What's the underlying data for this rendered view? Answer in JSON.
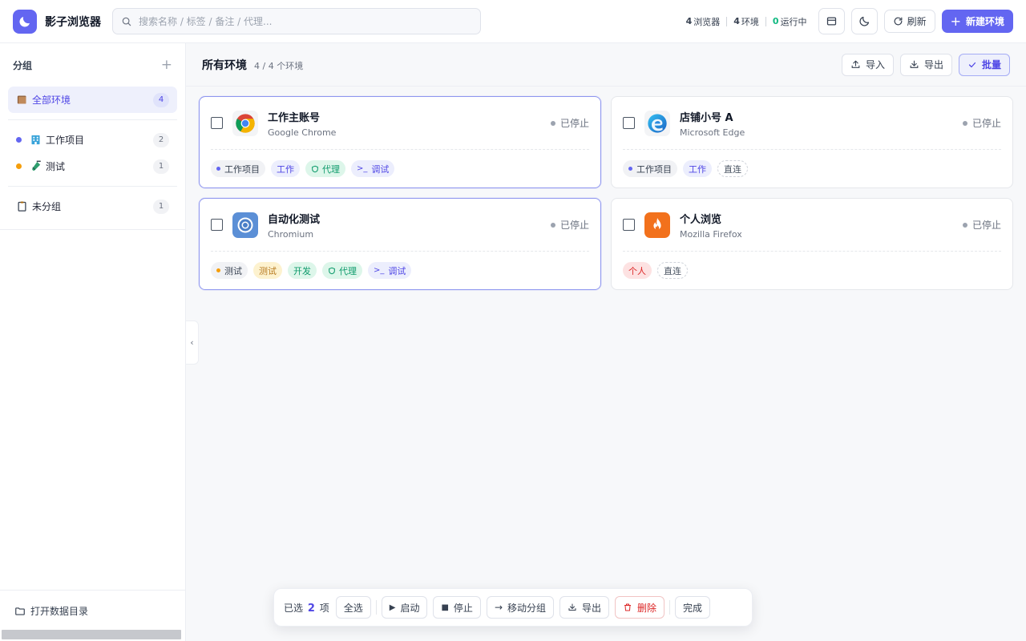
{
  "app": {
    "name": "影子浏览器"
  },
  "search": {
    "placeholder": "搜索名称 / 标签 / 备注 / 代理..."
  },
  "stats": {
    "browsers_count": "4",
    "browsers_label": "浏览器",
    "envs_count": "4",
    "envs_label": "环境",
    "running_count": "0",
    "running_label": "运行中"
  },
  "toolbar": {
    "refresh_label": "刷新",
    "new_label": "新建环境"
  },
  "sidebar": {
    "title": "分组",
    "all": {
      "label": "全部环境",
      "count": "4"
    },
    "groups": [
      {
        "label": "工作项目",
        "count": "2",
        "color": "#6366f1"
      },
      {
        "label": "测试",
        "count": "1",
        "color": "#f59e0b"
      }
    ],
    "ungrouped": {
      "label": "未分组",
      "count": "1"
    },
    "open_dir_label": "打开数据目录"
  },
  "main": {
    "title": "所有环境",
    "subtitle": "4 / 4 个环境",
    "import_label": "导入",
    "export_label": "导出",
    "batch_label": "批量"
  },
  "cards": [
    {
      "name": "工作主账号",
      "browser": "Google Chrome",
      "status": "已停止",
      "selected": true,
      "icon": "chrome-icon",
      "group": "工作项目",
      "tags": [
        "工作"
      ],
      "proxy": "代理",
      "debug": "调试"
    },
    {
      "name": "店铺小号 A",
      "browser": "Microsoft Edge",
      "status": "已停止",
      "selected": false,
      "icon": "edge-icon",
      "group": "工作项目",
      "tags": [
        "工作"
      ],
      "direct": "直连"
    },
    {
      "name": "自动化测试",
      "browser": "Chromium",
      "status": "已停止",
      "selected": true,
      "icon": "chromium-icon",
      "group": "测试",
      "tags": [
        "测试",
        "开发"
      ],
      "proxy": "代理",
      "debug": "调试"
    },
    {
      "name": "个人浏览",
      "browser": "Mozilla Firefox",
      "status": "已停止",
      "selected": false,
      "icon": "firefox-icon",
      "tags": [
        "个人"
      ],
      "direct": "直连"
    }
  ],
  "batch_bar": {
    "selected_prefix": "已选",
    "selected_count": "2",
    "selected_suffix": "项",
    "select_all": "全选",
    "start": "启动",
    "stop": "停止",
    "move_group": "移动分组",
    "export": "导出",
    "delete": "删除",
    "done": "完成"
  },
  "colors": {
    "accent": "#6366f1",
    "running": "#10b981",
    "danger": "#dc2626"
  }
}
